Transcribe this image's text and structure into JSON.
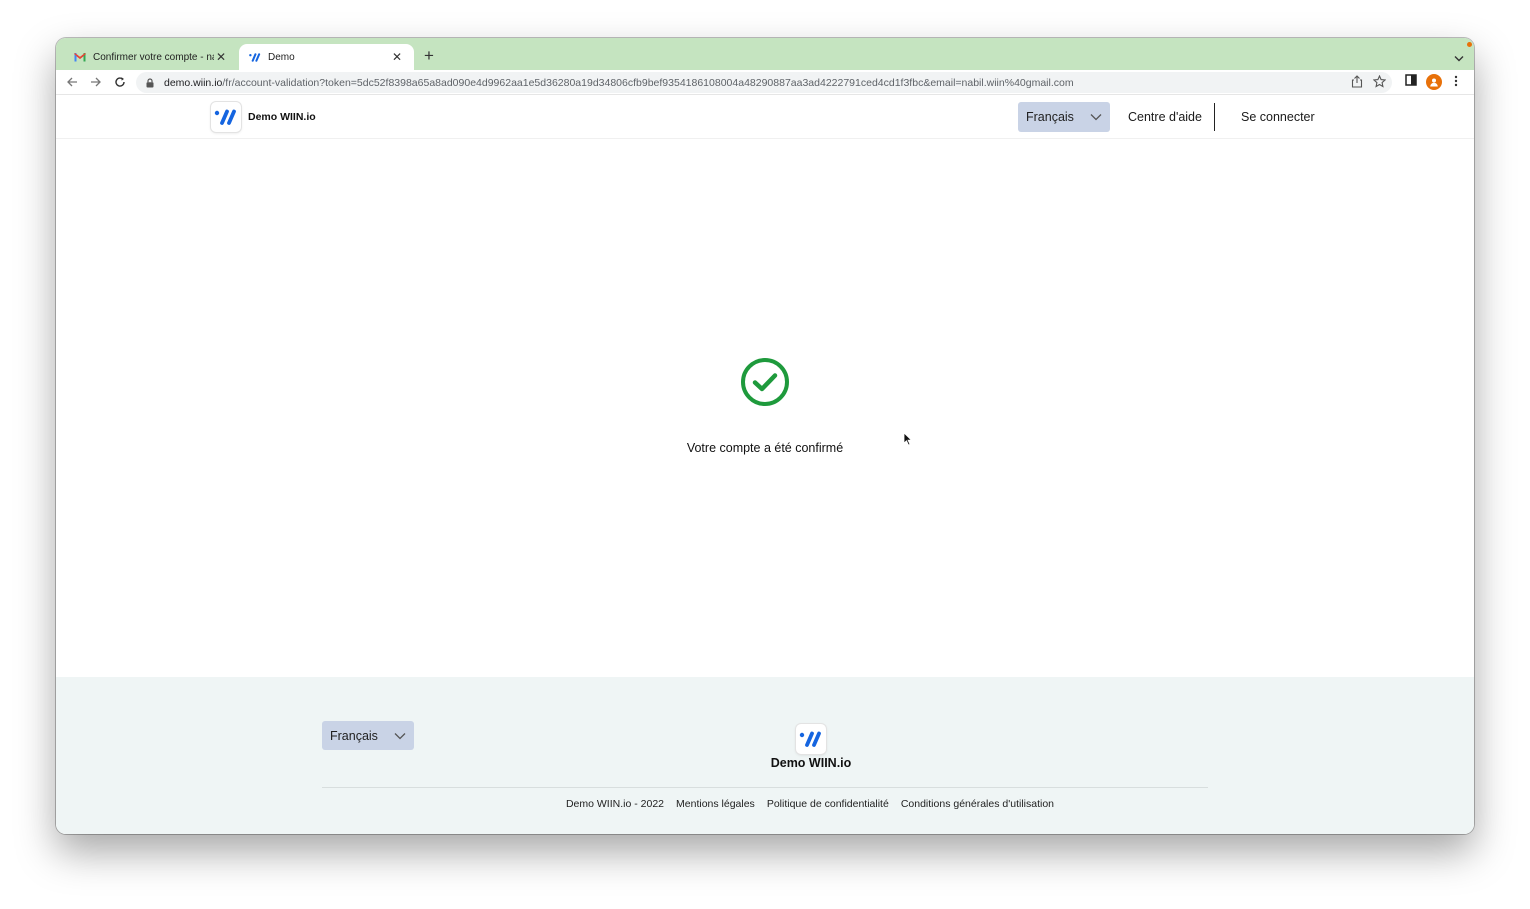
{
  "browser": {
    "tabs": [
      {
        "title": "Confirmer votre compte - nabil",
        "icon": "gmail-icon",
        "active": false
      },
      {
        "title": "Demo",
        "icon": "wiin-logo-icon",
        "active": true
      }
    ],
    "new_tab_symbol": "+",
    "close_symbol": "✕",
    "url_host": "demo.wiin.io",
    "url_path": "/fr/account-validation?token=5dc52f8398a65a8ad090e4d9962aa1e5d36280a19d34806cfb9bef9354186108004a48290887aa3ad4222791ced4cd1f3fbc&email=nabil.wiin%40gmail.com"
  },
  "header": {
    "brand": "Demo WIIN.io",
    "language": "Français",
    "help": "Centre d'aide",
    "login": "Se connecter"
  },
  "main": {
    "message": "Votre compte a été confirmé",
    "status_color": "#1e9a3c"
  },
  "footer": {
    "language": "Français",
    "brand": "Demo WIIN.io",
    "links": [
      "Demo WIIN.io - 2022",
      "Mentions légales",
      "Politique de confidentialité",
      "Conditions générales d'utilisation"
    ]
  },
  "colors": {
    "tabstrip": "#c5e4c0",
    "select_bg": "#c9d3e6",
    "footer_bg": "#eff5f5",
    "brand_blue": "#1565e0"
  }
}
